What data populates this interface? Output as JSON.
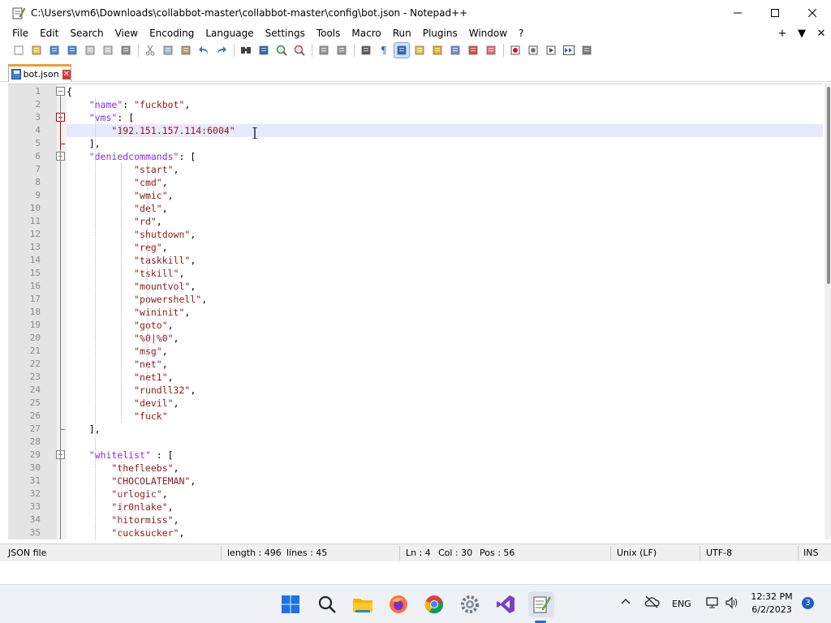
{
  "window": {
    "title": "C:\\Users\\vm6\\Downloads\\collabbot-master\\collabbot-master\\config\\bot.json - Notepad++"
  },
  "menu": {
    "items": [
      "File",
      "Edit",
      "Search",
      "View",
      "Encoding",
      "Language",
      "Settings",
      "Tools",
      "Macro",
      "Run",
      "Plugins",
      "Window",
      "?"
    ],
    "right": [
      "+",
      "▼",
      "✕"
    ]
  },
  "toolbar": {
    "buttons": [
      "new-file-icon",
      "open-file-icon",
      "save-icon",
      "save-all-icon",
      "close-icon",
      "close-all-icon",
      "print-icon",
      "cut-icon",
      "copy-icon",
      "paste-icon",
      "undo-icon",
      "redo-icon",
      "find-icon",
      "replace-icon",
      "zoom-in-icon",
      "zoom-out-icon",
      "sync-vertical-icon",
      "sync-horizontal-icon",
      "word-wrap-icon",
      "show-all-chars-icon",
      "indent-guide-icon",
      "user-defined-lang-icon",
      "doc-map-icon",
      "function-list-icon",
      "folder-as-workspace-icon",
      "monitoring-icon",
      "record-macro-icon",
      "stop-macro-icon",
      "play-macro-icon",
      "run-macro-multiple-icon",
      "save-macro-icon"
    ]
  },
  "tab": {
    "label": "bot.json",
    "close": "✕"
  },
  "editor": {
    "current_line": 4,
    "lines": [
      {
        "n": "1",
        "text": "{"
      },
      {
        "n": "2",
        "text": "    \"name\": \"fuckbot\","
      },
      {
        "n": "3",
        "text": "    \"vms\": ["
      },
      {
        "n": "4",
        "text": "        \"192.151.157.114:6004\""
      },
      {
        "n": "5",
        "text": "    ],"
      },
      {
        "n": "6",
        "text": "    \"deniedcommands\": ["
      },
      {
        "n": "7",
        "text": "            \"start\","
      },
      {
        "n": "8",
        "text": "            \"cmd\","
      },
      {
        "n": "9",
        "text": "            \"wmic\","
      },
      {
        "n": "10",
        "text": "            \"del\","
      },
      {
        "n": "11",
        "text": "            \"rd\","
      },
      {
        "n": "12",
        "text": "            \"shutdown\","
      },
      {
        "n": "13",
        "text": "            \"reg\","
      },
      {
        "n": "14",
        "text": "            \"taskkill\","
      },
      {
        "n": "15",
        "text": "            \"tskill\","
      },
      {
        "n": "16",
        "text": "            \"mountvol\","
      },
      {
        "n": "17",
        "text": "            \"powershell\","
      },
      {
        "n": "18",
        "text": "            \"wininit\","
      },
      {
        "n": "19",
        "text": "            \"goto\","
      },
      {
        "n": "20",
        "text": "            \"%0|%0\","
      },
      {
        "n": "21",
        "text": "            \"msg\","
      },
      {
        "n": "22",
        "text": "            \"net\","
      },
      {
        "n": "23",
        "text": "            \"net1\","
      },
      {
        "n": "24",
        "text": "            \"rundll32\","
      },
      {
        "n": "25",
        "text": "            \"devil\","
      },
      {
        "n": "26",
        "text": "            \"fuck\""
      },
      {
        "n": "27",
        "text": "    ],"
      },
      {
        "n": "28",
        "text": ""
      },
      {
        "n": "29",
        "text": "    \"whitelist\" : ["
      },
      {
        "n": "30",
        "text": "        \"thefleebs\","
      },
      {
        "n": "31",
        "text": "        \"CHOCOLATEMAN\","
      },
      {
        "n": "32",
        "text": "        \"urlogic\","
      },
      {
        "n": "33",
        "text": "        \"ir0nlake\","
      },
      {
        "n": "34",
        "text": "        \"hitormiss\","
      },
      {
        "n": "35",
        "text": "        \"cucksucker\","
      }
    ]
  },
  "status": {
    "file_type": "JSON file",
    "length": "length : 496",
    "lines": "lines : 45",
    "ln": "Ln : 4",
    "col": "Col : 30",
    "pos": "Pos : 56",
    "eol": "Unix (LF)",
    "encoding": "UTF-8",
    "mode": "INS"
  },
  "taskbar": {
    "apps": [
      "start-icon",
      "search-icon",
      "file-explorer-icon",
      "firefox-icon",
      "chrome-icon",
      "settings-icon",
      "visual-studio-icon",
      "notepadpp-icon"
    ],
    "language": "ENG",
    "time": "12:32 PM",
    "date": "6/2/2023",
    "notifications": "3"
  }
}
